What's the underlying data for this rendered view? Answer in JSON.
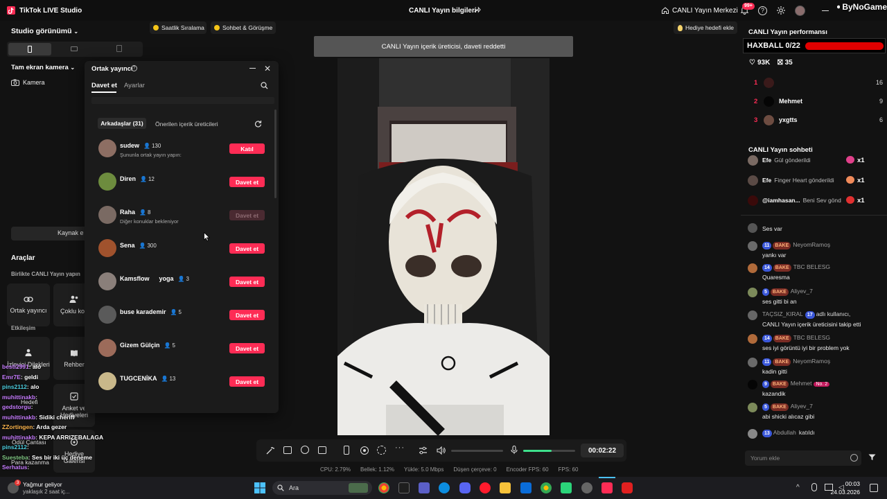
{
  "titlebar": {
    "app_name": "TikTok LIVE Studio",
    "center_title": "CANLI Yayın bilgileri",
    "live_center": "CANLI Yayın Merkezi",
    "notif_badge": "99+",
    "watermark": "ByNoGame"
  },
  "left": {
    "studio_view": "Studio görünümü",
    "camera_scene": "Tam ekran kamera",
    "camera_source": "Kamera",
    "add_source": "Kaynak e",
    "tools_title": "Araçlar",
    "live_together": "Birlikte CANLI Yayın yapın",
    "tool_cohost": "Ortak yayıncı",
    "tool_multi": "Çoklu kon",
    "engagement": "Etkileşim",
    "tool_viewer_wishes": "İzleyici Dilekleri",
    "tool_guide": "Rehber",
    "tool_goal": "Hedefi",
    "tool_poll": "Anket ve Hediyeleri",
    "tool_gift_bag": "Ödül Çantası",
    "tool_gift_gallery": "Hediye Galerisi",
    "tool_earn": "Para kazanma"
  },
  "overlay_chat": [
    {
      "user": "besti2991",
      "text": "alo",
      "color": "#c77dff"
    },
    {
      "user": "Emr7E",
      "text": "geldi",
      "color": "#c77dff"
    },
    {
      "user": "pins2112",
      "text": "alo",
      "color": "#4dd0e1"
    },
    {
      "user": "muhittinakb",
      "text": "",
      "color": "#c77dff"
    },
    {
      "user": "gedstorgu",
      "text": "",
      "color": "#c77dff"
    },
    {
      "user": "muhittinakb",
      "text": "Sidiki cheriff",
      "color": "#c77dff"
    },
    {
      "user": "ZZortingen",
      "text": "Arda gezer",
      "color": "#ffb74d"
    },
    {
      "user": "muhittinakb",
      "text": "KEPA ARRIZEBALAGA",
      "color": "#c77dff"
    },
    {
      "user": "pins2112",
      "text": "",
      "color": "#4dd0e1"
    },
    {
      "user": "Suesteba",
      "text": "Ses bir iki üç deneme",
      "color": "#81c784"
    },
    {
      "user": "Serhatus",
      "text": "",
      "color": "#c77dff"
    }
  ],
  "top_chips": {
    "hourly_rank": "Saatlik Sıralama",
    "chat_meet": "Sohbet & Görüşme",
    "gift_goal": "Hediye hedefi ekle"
  },
  "toast": "CANLI Yayın içerik üreticisi, daveti reddetti",
  "modal": {
    "title": "Ortak yayıncı",
    "tab_invite": "Davet et",
    "tab_settings": "Ayarlar",
    "sub_friends": "Arkadaşlar (31)",
    "sub_suggested": "Önerilen içerik üreticileri",
    "friends": [
      {
        "name": "sudew",
        "count": "130",
        "sub": "Şununla ortak yayın yapın:",
        "button": "Katıl",
        "disabled": false,
        "color": "#8d6e63"
      },
      {
        "name": "Diren",
        "count": "12",
        "sub": "",
        "button": "Davet et",
        "disabled": false,
        "color": "#6d8c3e"
      },
      {
        "name": "Raha",
        "count": "8",
        "sub": "Diğer konuklar bekleniyor",
        "button": "Davet et",
        "disabled": true,
        "color": "#7a6a63"
      },
      {
        "name": "Sena",
        "count": "300",
        "sub": "",
        "button": "Davet et",
        "disabled": false,
        "color": "#a0522d"
      },
      {
        "name": "Kamsflow",
        "count": "3",
        "sub": "",
        "button": "Davet et",
        "disabled": false,
        "color": "#8a7f7a",
        "suffix": "yoga"
      },
      {
        "name": "buse karademir",
        "count": "5",
        "sub": "",
        "button": "Davet et",
        "disabled": false,
        "color": "#5a5a5a"
      },
      {
        "name": "Gizem Gülçin",
        "count": "5",
        "sub": "",
        "button": "Davet et",
        "disabled": false,
        "color": "#9c6b5a"
      },
      {
        "name": "TUGCENİKA",
        "count": "13",
        "sub": "",
        "button": "Davet et",
        "disabled": false,
        "color": "#c9b88a"
      }
    ]
  },
  "right": {
    "perf_title": "CANLI Yayın performansı",
    "haxball": "HAXBALL 0/22",
    "haxball_progress": 0.0,
    "likes": "93K",
    "gifts": "35",
    "ranking": [
      {
        "rank": "1",
        "name": "",
        "score": "16"
      },
      {
        "rank": "2",
        "name": "Mehmet",
        "score": "9"
      },
      {
        "rank": "3",
        "name": "yxgtts",
        "score": "6"
      }
    ],
    "chat_title": "CANLI Yayın sohbeti",
    "gift_events": [
      {
        "user": "Efe",
        "text": "Gül gönderildi",
        "mult": "x1"
      },
      {
        "user": "Efe",
        "text": "Finger Heart gönderildi",
        "mult": "x1"
      },
      {
        "user": "@iamhasan...",
        "text": "Beni Sev gönd",
        "mult": "x1"
      }
    ],
    "messages": [
      {
        "level": "",
        "club": "",
        "user": "",
        "text": "Ses var"
      },
      {
        "level": "11",
        "club": "BAKE",
        "user": "NeyomRamoş",
        "text": "yankı var"
      },
      {
        "level": "14",
        "club": "BAKE",
        "user": "TBC BELESG",
        "text": "Quaresma"
      },
      {
        "level": "5",
        "club": "BAKE",
        "user": "Aliyev_7",
        "text": "ses gitti bi an"
      },
      {
        "level": "17",
        "club": "",
        "user": "TAÇSIZ_KIRAL",
        "text": "CANLI Yayın içerik üreticisini takip etti",
        "prefix": "adlı kullanıcı,"
      },
      {
        "level": "14",
        "club": "BAKE",
        "user": "TBC BELESG",
        "text": "ses iyi görüntü iyi bir problem yok"
      },
      {
        "level": "11",
        "club": "BAKE",
        "user": "NeyomRamoş",
        "text": "kadin gitti"
      },
      {
        "level": "9",
        "club": "BAKE",
        "user": "Mehmet",
        "text": "kazandik",
        "badge": "No. 2"
      },
      {
        "level": "5",
        "club": "BAKE",
        "user": "Aliyev_7",
        "text": "abi shicki alıcaz gibi"
      },
      {
        "level": "13",
        "club": "",
        "user": "Abdullah",
        "text": "katıldı"
      }
    ],
    "comment_placeholder": "Yorum ekle"
  },
  "controls": {
    "timer": "00:02:22",
    "volume_level": 0.0,
    "mic_level": 0.55
  },
  "stats": {
    "cpu": "CPU: 2.79%",
    "memory": "Bellek: 1.12%",
    "upload": "Yükle: 5.0 Mbps",
    "dropped": "Düşen çerçeve: 0",
    "encoder": "Encoder FPS: 60",
    "fps": "FPS: 60"
  },
  "taskbar": {
    "weather_title": "Yağmur geliyor",
    "weather_sub": "yaklaşık 2 saat iç...",
    "weather_badge": "3",
    "search": "Ara",
    "time": "00:03",
    "date": "24.03.2026"
  },
  "colors": {
    "accent": "#fe2c55",
    "panel": "#121212",
    "modal": "#1b1b1b"
  }
}
